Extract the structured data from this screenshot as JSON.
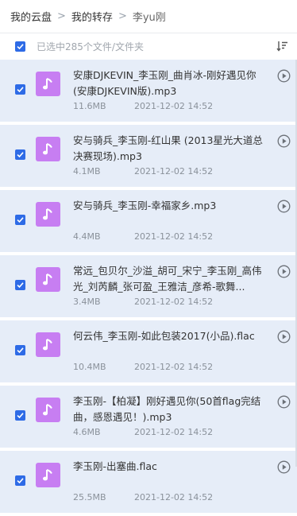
{
  "breadcrumb": {
    "items": [
      {
        "label": "我的云盘"
      },
      {
        "label": "我的转存"
      },
      {
        "label": "李yu刚"
      }
    ]
  },
  "selection": {
    "text": "已选中285个文件/文件夹"
  },
  "colors": {
    "accent": "#2e6be6",
    "row_bg": "#e6edf8",
    "thumb": "#c77ef2"
  },
  "files": [
    {
      "name": "安康DJKEVIN_李玉刚_曲肖冰-刚好遇见你(安康DJKEVIN版).mp3",
      "size": "11.6MB",
      "date": "2021-12-02 14:52",
      "icon": "music-note-icon",
      "checked": true
    },
    {
      "name": "安与骑兵_李玉刚-红山果 (2013星光大道总决赛现场).mp3",
      "size": "4.1MB",
      "date": "2021-12-02 14:52",
      "icon": "music-note-icon",
      "checked": true
    },
    {
      "name": "安与骑兵_李玉刚-幸福家乡.mp3",
      "size": "4.4MB",
      "date": "2021-12-02 14:52",
      "icon": "music-note-icon",
      "checked": true
    },
    {
      "name": "常远_包贝尔_沙溢_胡可_宋宁_李玉刚_高伟光_刘芮麟_张可盈_王雅洁_彦希-歌舞...",
      "size": "3.4MB",
      "date": "2021-12-02 14:52",
      "icon": "music-note-icon",
      "checked": true
    },
    {
      "name": "何云伟_李玉刚-如此包装2017(小品).flac",
      "size": "10.4MB",
      "date": "2021-12-02 14:52",
      "icon": "music-note-icon",
      "checked": true
    },
    {
      "name": "李玉刚-【柏凝】刚好遇见你(50首flag完结曲，感恩遇见！).mp3",
      "size": "4.6MB",
      "date": "2021-12-02 14:52",
      "icon": "music-note-icon",
      "checked": true
    },
    {
      "name": "李玉刚-出塞曲.flac",
      "size": "25.5MB",
      "date": "2021-12-02 14:52",
      "icon": "music-note-icon",
      "checked": true
    }
  ]
}
